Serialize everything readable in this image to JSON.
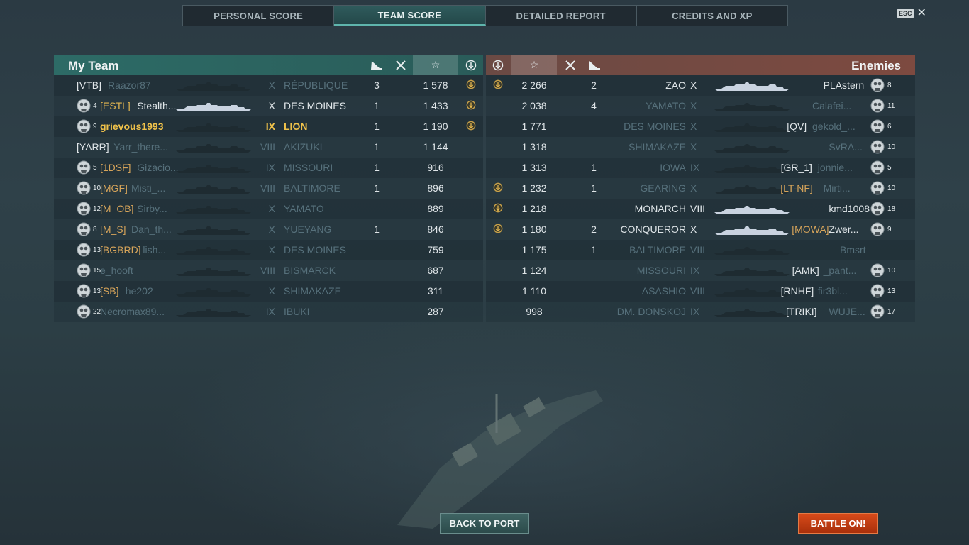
{
  "tabs": [
    {
      "label": "PERSONAL SCORE",
      "active": false
    },
    {
      "label": "TEAM SCORE",
      "active": true
    },
    {
      "label": "DETAILED REPORT",
      "active": false
    },
    {
      "label": "CREDITS AND XP",
      "active": false
    }
  ],
  "esc_label": "ESC",
  "close_icon": "close-icon",
  "my_team": {
    "title": "My Team",
    "header_icons": [
      "torpedo-icon",
      "planes-icon",
      "star-icon",
      "achievement-icon"
    ],
    "rows": [
      {
        "rank": "",
        "clan": "[VTB]",
        "name": "Raazor87",
        "tier": "X",
        "ship": "RÉPUBLIQUE",
        "kills": "3",
        "xp": "1 578",
        "medal": true,
        "rank_badge": false,
        "style": "dim"
      },
      {
        "rank": "4",
        "clan": "[ESTL]",
        "name": "Stealth...",
        "tier": "X",
        "ship": "DES MOINES",
        "kills": "1",
        "xp": "1 433",
        "medal": true,
        "rank_badge": true,
        "style": "white"
      },
      {
        "rank": "9",
        "clan": "",
        "name": "grievous1993",
        "tier": "IX",
        "ship": "LION",
        "kills": "1",
        "xp": "1 190",
        "medal": true,
        "rank_badge": true,
        "style": "hl"
      },
      {
        "rank": "",
        "clan": "[YARR]",
        "name": "Yarr_there...",
        "tier": "VIII",
        "ship": "AKIZUKI",
        "kills": "1",
        "xp": "1 144",
        "medal": false,
        "rank_badge": false,
        "style": "dim"
      },
      {
        "rank": "5",
        "clan": "[1DSF]",
        "name": "Gizacio...",
        "tier": "IX",
        "ship": "MISSOURI",
        "kills": "1",
        "xp": "916",
        "medal": false,
        "rank_badge": true,
        "style": "dim"
      },
      {
        "rank": "10",
        "clan": "[MGF]",
        "name": "Misti_...",
        "tier": "VIII",
        "ship": "BALTIMORE",
        "kills": "1",
        "xp": "896",
        "medal": false,
        "rank_badge": true,
        "style": "dim"
      },
      {
        "rank": "12",
        "clan": "[M_OB]",
        "name": "Sirby...",
        "tier": "X",
        "ship": "YAMATO",
        "kills": "",
        "xp": "889",
        "medal": false,
        "rank_badge": true,
        "style": "dim"
      },
      {
        "rank": "8",
        "clan": "[M_S]",
        "name": "Dan_th...",
        "tier": "X",
        "ship": "YUEYANG",
        "kills": "1",
        "xp": "846",
        "medal": false,
        "rank_badge": true,
        "style": "dim"
      },
      {
        "rank": "13",
        "clan": "[BGBRD]",
        "name": "lish...",
        "tier": "X",
        "ship": "DES MOINES",
        "kills": "",
        "xp": "759",
        "medal": false,
        "rank_badge": true,
        "style": "dim"
      },
      {
        "rank": "15",
        "clan": "",
        "name": "e_hooft",
        "tier": "VIII",
        "ship": "BISMARCK",
        "kills": "",
        "xp": "687",
        "medal": false,
        "rank_badge": true,
        "style": "dim"
      },
      {
        "rank": "13",
        "clan": "[SB]",
        "name": "he202",
        "tier": "X",
        "ship": "SHIMAKAZE",
        "kills": "",
        "xp": "311",
        "medal": false,
        "rank_badge": true,
        "style": "dim"
      },
      {
        "rank": "22",
        "clan": "",
        "name": "Necromax89...",
        "tier": "IX",
        "ship": "IBUKI",
        "kills": "",
        "xp": "287",
        "medal": false,
        "rank_badge": true,
        "style": "dim"
      }
    ]
  },
  "enemies": {
    "title": "Enemies",
    "rows": [
      {
        "medal": true,
        "xp": "2 266",
        "kills": "2",
        "planes": "",
        "ship": "ZAO",
        "tier": "X",
        "clan": "",
        "name": "PLAstern",
        "rank": "8",
        "style": "white"
      },
      {
        "medal": false,
        "xp": "2 038",
        "kills": "4",
        "planes": "",
        "ship": "YAMATO",
        "tier": "X",
        "clan": "",
        "name": "Calafei...",
        "rank": "11",
        "style": "dim"
      },
      {
        "medal": false,
        "xp": "1 771",
        "kills": "",
        "planes": "",
        "ship": "DES MOINES",
        "tier": "X",
        "clan": "[QV]",
        "name": "gekold_...",
        "rank": "6",
        "style": "dim"
      },
      {
        "medal": false,
        "xp": "1 318",
        "kills": "",
        "planes": "",
        "ship": "SHIMAKAZE",
        "tier": "X",
        "clan": "",
        "name": "SvRA...",
        "rank": "10",
        "style": "dim"
      },
      {
        "medal": false,
        "xp": "1 313",
        "kills": "1",
        "planes": "",
        "ship": "IOWA",
        "tier": "IX",
        "clan": "[GR_1]",
        "name": "jonnie...",
        "rank": "5",
        "style": "dim"
      },
      {
        "medal": true,
        "xp": "1 232",
        "kills": "1",
        "planes": "",
        "ship": "GEARING",
        "tier": "X",
        "clan": "[LT-NF]",
        "name": "Mirti...",
        "rank": "10",
        "style": "dim"
      },
      {
        "medal": true,
        "xp": "1 218",
        "kills": "",
        "planes": "",
        "ship": "MONARCH",
        "tier": "VIII",
        "clan": "",
        "name": "kmd1008",
        "rank": "18",
        "style": "white"
      },
      {
        "medal": true,
        "xp": "1 180",
        "kills": "2",
        "planes": "",
        "ship": "CONQUEROR",
        "tier": "X",
        "clan": "[MOWA]",
        "name": "Zwer...",
        "rank": "9",
        "style": "white"
      },
      {
        "medal": false,
        "xp": "1 175",
        "kills": "1",
        "planes": "",
        "ship": "BALTIMORE",
        "tier": "VIII",
        "clan": "",
        "name": "Bmsrt",
        "rank": "",
        "style": "dim"
      },
      {
        "medal": false,
        "xp": "1 124",
        "kills": "",
        "planes": "",
        "ship": "MISSOURI",
        "tier": "IX",
        "clan": "[AMK]",
        "name": "_pant...",
        "rank": "10",
        "style": "dim"
      },
      {
        "medal": false,
        "xp": "1 110",
        "kills": "",
        "planes": "",
        "ship": "ASASHIO",
        "tier": "VIII",
        "clan": "[RNHF]",
        "name": "fir3bl...",
        "rank": "13",
        "style": "dim"
      },
      {
        "medal": false,
        "xp": "998",
        "kills": "",
        "planes": "",
        "ship": "DM. DONSKOJ",
        "tier": "IX",
        "clan": "[TRIKI]",
        "name": "WUJE...",
        "rank": "17",
        "style": "dim"
      }
    ]
  },
  "buttons": {
    "back_to_port": "BACK TO PORT",
    "battle_on": "BATTLE ON!"
  },
  "colors": {
    "my_team_header": "#2d6b66",
    "enemies_header": "#7d4a40",
    "player_highlight": "#f0c24a",
    "battle_button": "#d84b1a"
  }
}
